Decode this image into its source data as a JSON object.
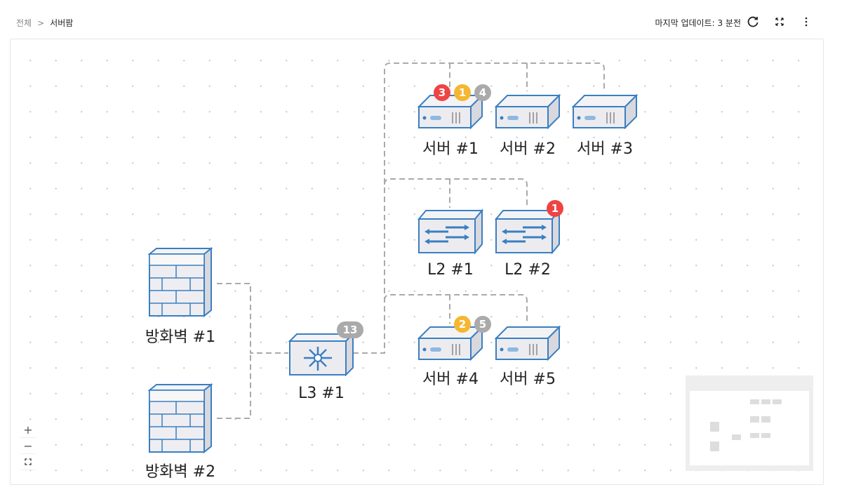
{
  "breadcrumb": {
    "root": "전체",
    "separator": ">",
    "current": "서버팜"
  },
  "status": {
    "last_update": "마지막 업데이트: 3 분전"
  },
  "icons": {
    "refresh": "refresh-icon",
    "fullscreen": "fullscreen-icon",
    "more": "more-vertical-icon"
  },
  "colors": {
    "critical": "#ef4444",
    "warning": "#f5b731",
    "info": "#aaaaaa",
    "device_stroke": "#3a7fc1",
    "device_fill": "#e9e9ee"
  },
  "nodes": {
    "fw1": {
      "label": "방화벽 #1"
    },
    "fw2": {
      "label": "방화벽 #2"
    },
    "l3": {
      "label": "L3 #1",
      "badges": [
        "13"
      ]
    },
    "srv1": {
      "label": "서버 #1",
      "badges": [
        "3",
        "1",
        "4"
      ]
    },
    "srv2": {
      "label": "서버 #2"
    },
    "srv3": {
      "label": "서버 #3"
    },
    "l2a": {
      "label": "L2 #1"
    },
    "l2b": {
      "label": "L2 #2",
      "badges": [
        "1"
      ]
    },
    "srv4": {
      "label": "서버 #4",
      "badges": [
        "2",
        "5"
      ]
    },
    "srv5": {
      "label": "서버 #5"
    }
  },
  "zoom": {
    "in": "+",
    "out": "−"
  }
}
